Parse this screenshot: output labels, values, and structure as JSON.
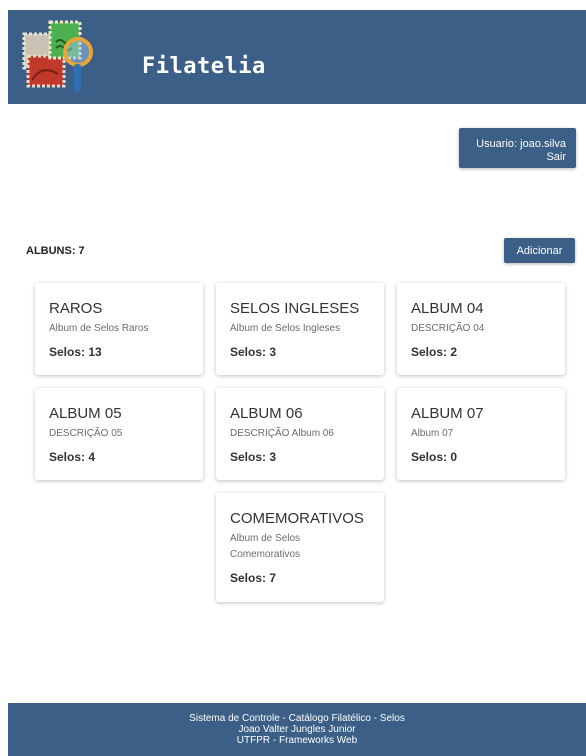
{
  "header": {
    "title": "Filatelia",
    "logo_icon": "stamp-magnifier-icon"
  },
  "user": {
    "label": "Usuario: joao.silva",
    "logout": "Sair"
  },
  "albums": {
    "count_label": "ALBUNS: 7",
    "add_label": "Adicionar",
    "items": [
      {
        "title": "RAROS",
        "description": "Album de Selos Raros",
        "count": "Selos: 13"
      },
      {
        "title": "SELOS INGLESES",
        "description": "Album de Selos Ingleses",
        "count": "Selos: 3"
      },
      {
        "title": "ALBUM 04",
        "description": "DESCRIÇÃO 04",
        "count": "Selos: 2"
      },
      {
        "title": "ALBUM 05",
        "description": "DESCRIÇÃO 05",
        "count": "Selos: 4"
      },
      {
        "title": "ALBUM 06",
        "description": "DESCRIÇÃO Album 06",
        "count": "Selos: 3"
      },
      {
        "title": "ALBUM 07",
        "description": "Album 07",
        "count": "Selos: 0"
      },
      {
        "title": "COMEMORATIVOS",
        "description": "Album de Selos Comemorativos",
        "count": "Selos: 7"
      }
    ]
  },
  "footer": {
    "line1": "Sistema de Controle - Catálogo Filatélico - Selos",
    "line2": "Joao Valter Jungles Junior",
    "line3": "UTFPR - Frameworks Web"
  },
  "colors": {
    "brand": "#3b5f86",
    "card_bg": "#ffffff"
  }
}
